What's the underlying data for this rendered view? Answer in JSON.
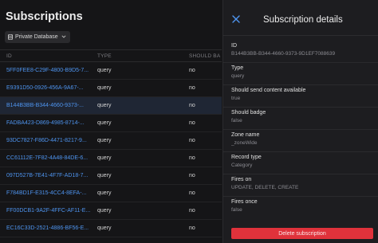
{
  "header": {
    "title": "Subscriptions"
  },
  "database_selector": {
    "label": "Private Database"
  },
  "table": {
    "columns": [
      "ID",
      "TYPE",
      "SHOULD BA"
    ],
    "rows": [
      {
        "id": "5FF0FEE8-C29F-4800-B9D5-7...",
        "type": "query",
        "should_badge": "no"
      },
      {
        "id": "E9391D50-0926-456A-9A67-...",
        "type": "query",
        "should_badge": "no"
      },
      {
        "id": "B144B3BB-B344-4660-9373-...",
        "type": "query",
        "should_badge": "no"
      },
      {
        "id": "FADBA423-D869-4985-8714-...",
        "type": "query",
        "should_badge": "no"
      },
      {
        "id": "93DC7827-F86D-4471-8217-9...",
        "type": "query",
        "should_badge": "no"
      },
      {
        "id": "CC61112E-7F82-4A48-84DE-6...",
        "type": "query",
        "should_badge": "no"
      },
      {
        "id": "097D527B-7E41-4F7F-AD18-7...",
        "type": "query",
        "should_badge": "no"
      },
      {
        "id": "F784BD1F-E315-4CC4-8EFA-...",
        "type": "query",
        "should_badge": "no"
      },
      {
        "id": "FF00DCB1-9A2F-4FFC-AF11-E...",
        "type": "query",
        "should_badge": "no"
      },
      {
        "id": "EC16C33D-2521-4886-BF56-E...",
        "type": "query",
        "should_badge": "no"
      }
    ],
    "selected_index": 2
  },
  "details": {
    "title": "Subscription details",
    "fields": [
      {
        "label": "ID",
        "value": "B144B3BB-B344-4660-9373-9D1EF7088639"
      },
      {
        "label": "Type",
        "value": "query"
      },
      {
        "label": "Should send content available",
        "value": "true"
      },
      {
        "label": "Should badge",
        "value": "false"
      },
      {
        "label": "Zone name",
        "value": "_zoneWide"
      },
      {
        "label": "Record type",
        "value": "Category"
      },
      {
        "label": "Fires on",
        "value": "UPDATE, DELETE, CREATE"
      },
      {
        "label": "Fires once",
        "value": "false"
      }
    ],
    "delete_label": "Delete subscription"
  },
  "colors": {
    "accent": "#4e94ef",
    "danger": "#e0323b",
    "background": "#151517",
    "panel": "#1d1d20"
  },
  "icons": {
    "close": "close-icon",
    "database": "database-icon",
    "dropdown": "chevron-down-icon"
  }
}
